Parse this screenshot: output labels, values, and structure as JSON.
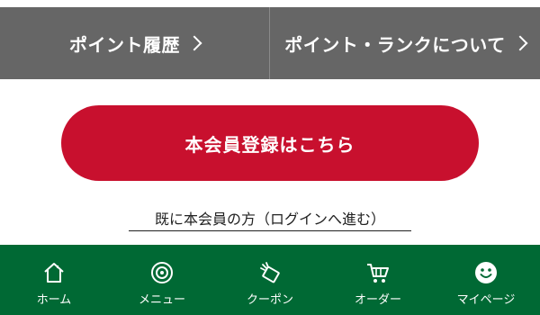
{
  "top_actions": {
    "points_history_label": "ポイント履歴",
    "points_rank_label": "ポイント・ランクについて"
  },
  "register": {
    "label": "本会員登録はこちら"
  },
  "login": {
    "label": "既に本会員の方（ログインへ進む）"
  },
  "bottom_nav": {
    "items": [
      {
        "label": "ホーム",
        "icon": "home-icon"
      },
      {
        "label": "メニュー",
        "icon": "menu-plate-icon"
      },
      {
        "label": "クーポン",
        "icon": "coupon-icon"
      },
      {
        "label": "オーダー",
        "icon": "cart-icon"
      },
      {
        "label": "マイページ",
        "icon": "smiley-icon"
      }
    ]
  },
  "colors": {
    "top_button_bg": "#666666",
    "register_bg": "#c8102e",
    "nav_bg": "#006934"
  }
}
